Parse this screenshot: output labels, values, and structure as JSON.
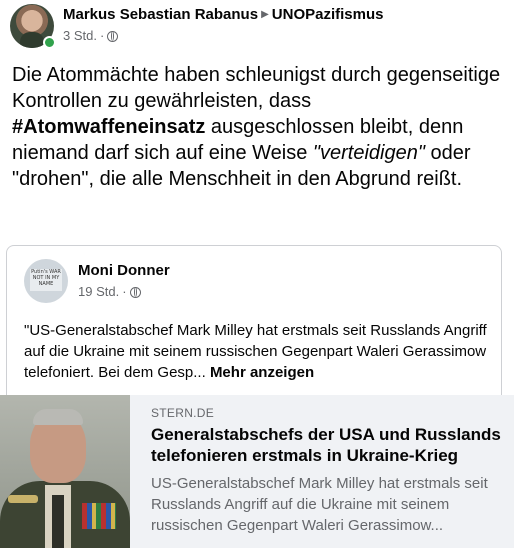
{
  "post": {
    "author": "Markus Sebastian Rabanus",
    "group": "UNOPazifismus",
    "time": "3 Std.",
    "separator": "·",
    "privacy_icon": "globe-icon",
    "text_part1": "Die Atommächte haben schleunigst durch gegenseitige Kontrollen zu gewährleisten, dass ",
    "hashtag": "#Atomwaffeneinsatz",
    "text_part2": " ausgeschlossen bleibt, denn niemand darf sich auf eine Weise ",
    "italic_word": "\"verteidigen\"",
    "text_part3": " oder \"drohen\", die alle Menschheit in den Abgrund reißt."
  },
  "shared": {
    "author": "Moni Donner",
    "time": "19 Std.",
    "separator": "·",
    "avatar_sign_text": "Putin's WAR NOT IN MY NAME",
    "text": "\"US-Generalstabschef Mark Milley hat erstmals seit Russlands Angriff auf die Ukraine mit seinem russischen Gegenpart Waleri Gerassimow telefoniert. Bei dem Gesp... ",
    "more_label": "Mehr anzeigen"
  },
  "link": {
    "domain": "STERN.DE",
    "title": "Generalstabschefs der USA und Russlands telefonieren erstmals in Ukraine-Krieg",
    "description": "US-Generalstabschef Mark Milley hat erstmals seit Russlands Angriff auf die Ukraine mit seinem russischen Gegenpart Waleri Gerassimow..."
  },
  "colors": {
    "online": "#31a24c",
    "secondary_text": "#65676b",
    "preview_bg": "#f0f2f5"
  }
}
